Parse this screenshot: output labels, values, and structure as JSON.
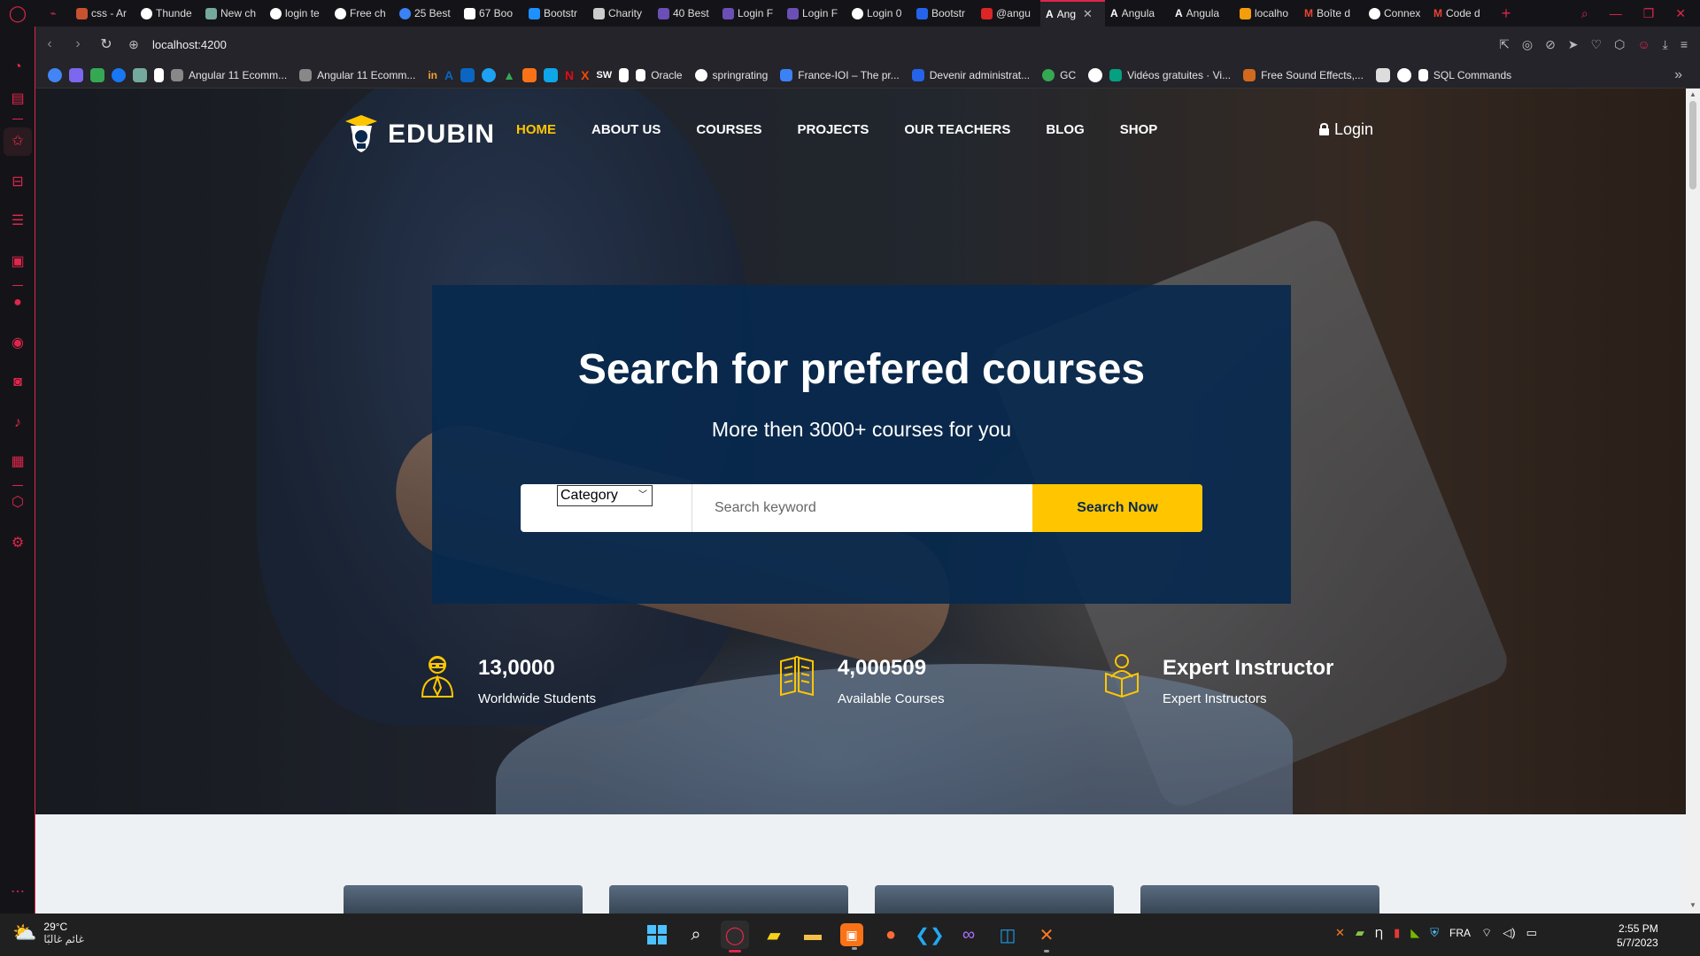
{
  "browser": {
    "tabs": [
      {
        "label": "",
        "color": "#e0264b"
      },
      {
        "label": "css - Ar",
        "color": "#c8522f"
      },
      {
        "label": "Thunde",
        "color": "#ffffff"
      },
      {
        "label": "New ch",
        "color": "#74aa9c"
      },
      {
        "label": "login te",
        "color": "#ffffff"
      },
      {
        "label": "Free ch",
        "color": "#ffffff"
      },
      {
        "label": "25 Best",
        "color": "#3b82f6"
      },
      {
        "label": "67 Boo",
        "color": "#ffffff"
      },
      {
        "label": "Bootstr",
        "color": "#1e90ff"
      },
      {
        "label": "Charity",
        "color": "#cccccc"
      },
      {
        "label": "40 Best",
        "color": "#6b4fb5"
      },
      {
        "label": "Login F",
        "color": "#6b4fb5"
      },
      {
        "label": "Login F",
        "color": "#6b4fb5"
      },
      {
        "label": "Login 0",
        "color": "#ffffff"
      },
      {
        "label": "Bootstr",
        "color": "#2563eb"
      },
      {
        "label": "@angu",
        "color": "#dc2626"
      },
      {
        "label": "Ang",
        "color": "#ffffff",
        "active": true
      },
      {
        "label": "Angula",
        "color": "#ffffff"
      },
      {
        "label": "Angula",
        "color": "#ffffff"
      },
      {
        "label": "localho",
        "color": "#f59e0b"
      },
      {
        "label": "Boîte d",
        "color": "#ea4335"
      },
      {
        "label": "Connex",
        "color": "#ffffff"
      },
      {
        "label": "Code d",
        "color": "#ea4335"
      }
    ],
    "url": "localhost:4200",
    "bookmarks": [
      {
        "label": "Angular 11 Ecomm...",
        "color": "#888888"
      },
      {
        "label": "Angular 11 Ecomm...",
        "color": "#888888"
      },
      {
        "label": "Oracle",
        "color": "#ffffff"
      },
      {
        "label": "springrating",
        "color": "#ffffff"
      },
      {
        "label": "France-IOI – The pr...",
        "color": "#3b82f6"
      },
      {
        "label": "Devenir administrat...",
        "color": "#2563eb"
      },
      {
        "label": "GC",
        "color": "#34a853"
      },
      {
        "label": "Vidéos gratuites · Vi...",
        "color": "#05a081"
      },
      {
        "label": "Free Sound Effects,...",
        "color": "#d2691e"
      },
      {
        "label": "SQL Commands",
        "color": "#ffffff"
      }
    ],
    "icon_bookmarks": [
      "#4285f4",
      "#7b68ee",
      "#34a853",
      "#1877f2",
      "#74aa9c",
      "#ffffff",
      "#f0a030",
      "#0a66c2",
      "#0a66c2",
      "#1da1f2",
      "#34a853",
      "#f97316",
      "#0ea5e9",
      "#e50914",
      "#ff4500",
      "#ffffff",
      "#ffffff"
    ],
    "icon_bookmark_labels": {
      "sw": "SW",
      "in": "in"
    }
  },
  "site": {
    "brand": "EDUBIN",
    "nav": [
      "HOME",
      "ABOUT US",
      "COURSES",
      "PROJECTS",
      "OUR TEACHERS",
      "BLOG",
      "SHOP"
    ],
    "login_label": "Login",
    "accent": "#ffc600",
    "panel_color": "#07294d"
  },
  "search": {
    "title": "Search for prefered courses",
    "subtitle": "More then 3000+ courses for you",
    "category_label": "Category",
    "placeholder": "Search keyword",
    "button_label": "Search Now"
  },
  "stats": [
    {
      "number": "13,0000",
      "label": "Worldwide Students",
      "icon": "student-icon"
    },
    {
      "number": "4,000509",
      "label": "Available Courses",
      "icon": "book-icon"
    },
    {
      "number": "Expert Instructor",
      "label": "Expert Instructors",
      "icon": "instructor-icon"
    }
  ],
  "taskbar": {
    "temperature": "29°C",
    "weather_desc": "غائم غالبًا",
    "language": "FRA",
    "time": "2:55 PM",
    "date": "5/7/2023"
  }
}
